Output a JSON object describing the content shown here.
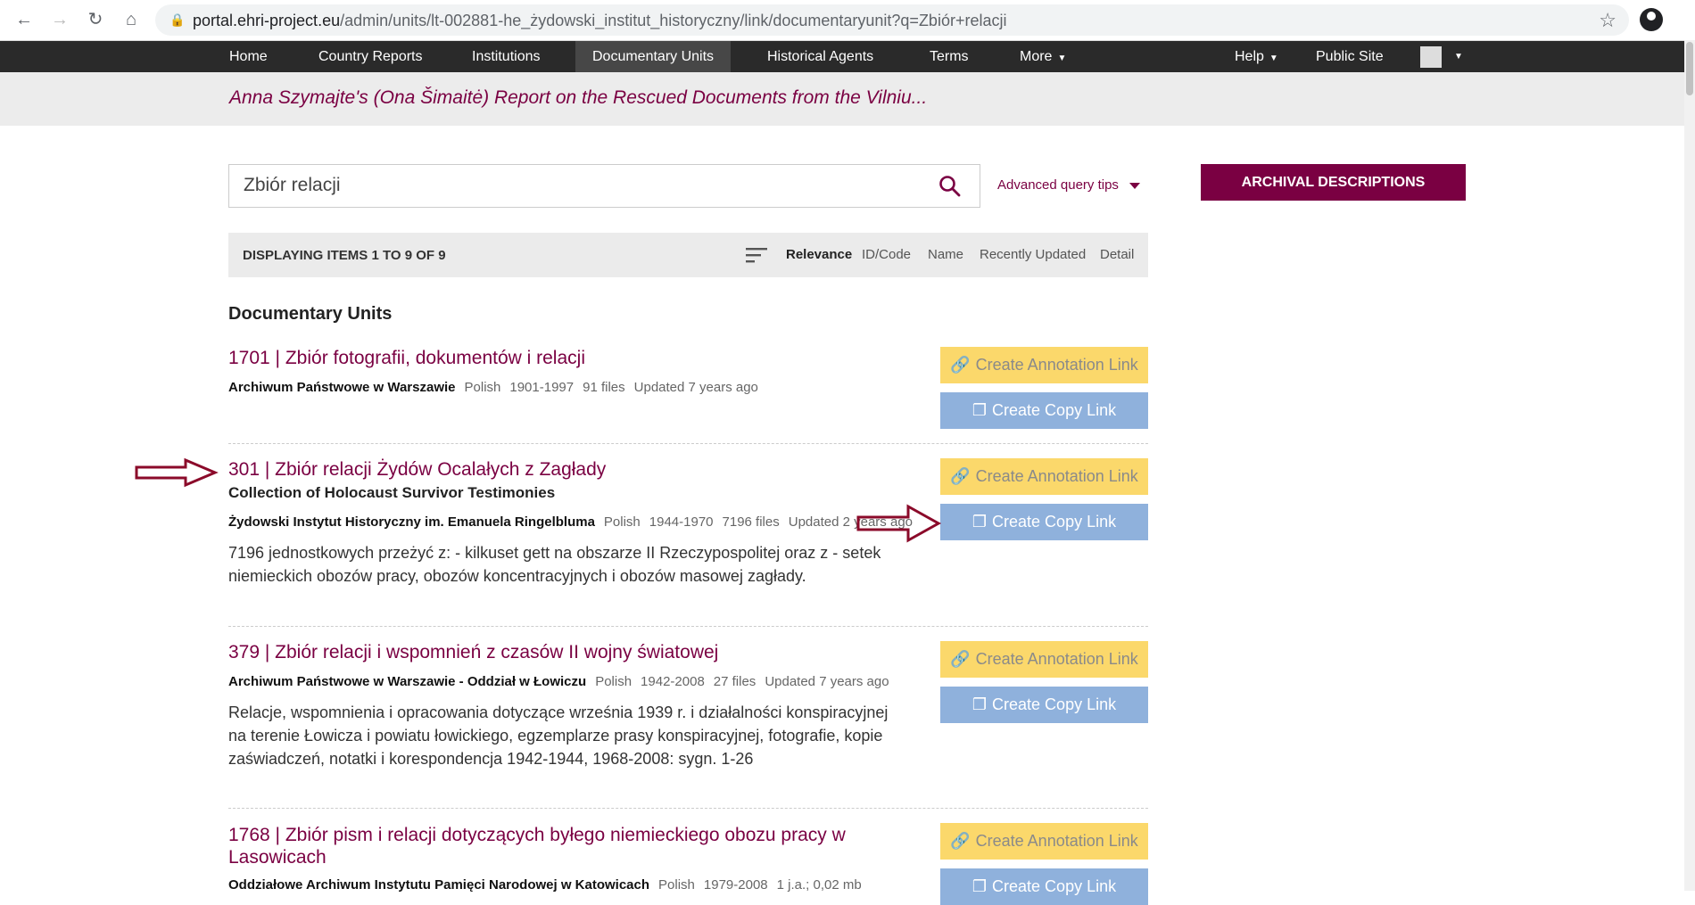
{
  "browser": {
    "url_host": "portal.ehri-project.eu",
    "url_path": "/admin/units/lt-002881-he_żydowski_institut_historyczny/link/documentaryunit?q=Zbiór+relacji"
  },
  "nav": {
    "home": "Home",
    "country_reports": "Country Reports",
    "institutions": "Institutions",
    "documentary_units": "Documentary Units",
    "historical_agents": "Historical Agents",
    "terms": "Terms",
    "more": "More",
    "help": "Help",
    "public_site": "Public Site"
  },
  "page": {
    "subtitle": "Anna Szymajte's (Ona Šimaitė) Report on the Rescued Documents from the Vilniu..."
  },
  "search": {
    "query": "Zbiór relacji",
    "advanced_tips": "Advanced query tips",
    "archival_button": "ARCHIVAL DESCRIPTIONS"
  },
  "results_bar": {
    "count_text": "DISPLAYING ITEMS 1 TO 9 OF 9",
    "sort_options": [
      "Relevance",
      "ID/Code",
      "Name",
      "Recently Updated",
      "Detail"
    ],
    "active_sort": "Relevance"
  },
  "section_title": "Documentary Units",
  "buttons": {
    "annotation": "Create Annotation Link",
    "copy": "Create Copy Link"
  },
  "items": [
    {
      "title": "1701 | Zbiór fotografii, dokumentów i relacji",
      "institution": "Archiwum Państwowe w Warszawie",
      "language": "Polish",
      "dates": "1901-1997",
      "files": "91 files",
      "updated": "Updated 7 years ago"
    },
    {
      "title": "301 | Zbiór relacji Żydów Ocalałych z Zagłady",
      "subtitle": "Collection of Holocaust Survivor Testimonies",
      "institution": "Żydowski Instytut Historyczny im. Emanuela Ringelbluma",
      "language": "Polish",
      "dates": "1944-1970",
      "files": "7196 files",
      "updated": "Updated 2 years ago",
      "description": "7196 jednostkowych przeżyć z: - kilkuset gett na obszarze II Rzeczypospolitej oraz z - setek niemieckich obozów pracy, obozów koncentracyjnych i obozów masowej zagłady."
    },
    {
      "title": "379 | Zbiór relacji i wspomnień z czasów II wojny światowej",
      "institution": "Archiwum Państwowe w Warszawie - Oddział w Łowiczu",
      "language": "Polish",
      "dates": "1942-2008",
      "files": "27 files",
      "updated": "Updated 7 years ago",
      "description": "Relacje, wspomnienia i opracowania dotyczące września 1939 r. i działalności konspiracyjnej na terenie Łowicza i powiatu łowickiego, egzemplarze prasy konspiracyjnej, fotografie, kopie zaświadczeń, notatki i korespondencja 1942-1944, 1968-2008: sygn. 1-26"
    },
    {
      "title": "1768 | Zbiór pism i relacji dotyczących byłego niemieckiego obozu pracy w Lasowicach",
      "institution": "Oddziałowe Archiwum Instytutu Pamięci Narodowej w Katowicach",
      "language": "Polish",
      "dates": "1979-2008",
      "files": "1 j.a.; 0,02 mb"
    }
  ],
  "colors": {
    "brand": "#7a0042",
    "annotation_button": "#fbd86b",
    "copy_button": "#8fb1dc",
    "navbar": "#2a2a2a"
  }
}
